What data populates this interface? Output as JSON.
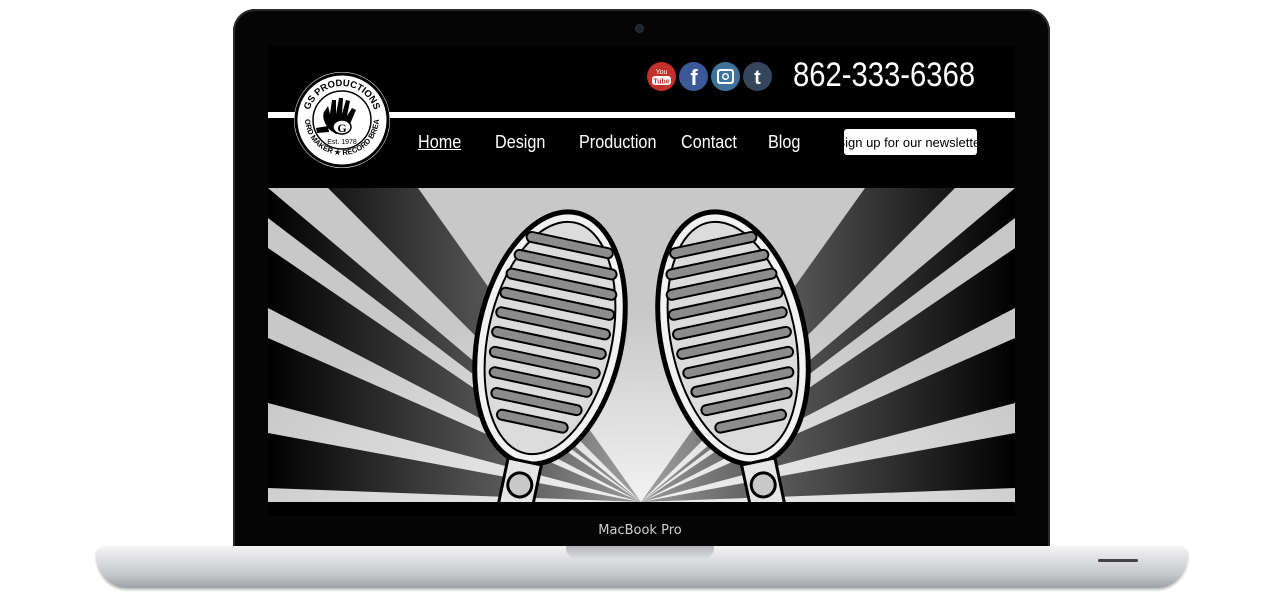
{
  "device": {
    "label": "MacBook Pro"
  },
  "site": {
    "logo": {
      "arc_top": "GS PRODUCTIONS",
      "arc_bottom": "RECORD MAKER ★ RECORD BREAKER",
      "established": "Est. 1978",
      "emblem": "G",
      "icon": "hand-icon"
    },
    "phone": "862-333-6368",
    "social": [
      {
        "name": "youtube",
        "label": "You Tube",
        "icon": "youtube-icon",
        "color": "#c4302b"
      },
      {
        "name": "facebook",
        "label": "f",
        "icon": "facebook-icon",
        "color": "#3b5998"
      },
      {
        "name": "instagram",
        "label": "instagram",
        "icon": "instagram-icon",
        "color": "#3f729b"
      },
      {
        "name": "tumblr",
        "label": "t",
        "icon": "tumblr-icon",
        "color": "#35465c"
      }
    ],
    "nav": {
      "items": [
        {
          "label": "Home",
          "active": true
        },
        {
          "label": "Design",
          "active": false
        },
        {
          "label": "Production",
          "active": false
        },
        {
          "label": "Contact",
          "active": false
        },
        {
          "label": "Blog",
          "active": false
        }
      ],
      "cta": "Sign up for our newsletter"
    },
    "hero": {
      "image": "two-vintage-microphones-illustration",
      "icon": "microphone-icon"
    }
  }
}
